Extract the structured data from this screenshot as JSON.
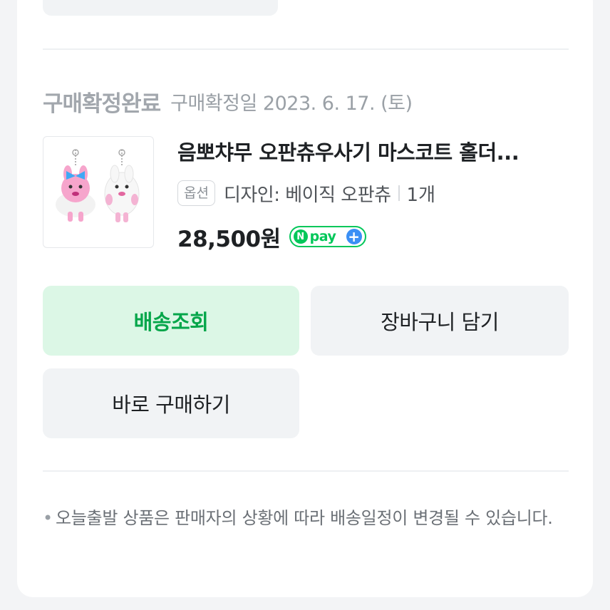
{
  "order": {
    "status_title": "구매확정완료",
    "status_date": "구매확정일 2023. 6. 17. (토)"
  },
  "product": {
    "name": "음뽀차무 오판츄우사기 마스코트 홀더 (판매 상품명 일부)",
    "name_display": "음뽀챠무 오판츄우사기 마스코트 홀더...",
    "option_badge": "옵션",
    "option_text": "디자인: 베이직 오판츄",
    "quantity": "1개",
    "price": "28,500원",
    "npay": {
      "n": "N",
      "label": "pay",
      "plus": "+"
    }
  },
  "buttons": {
    "track": "배송조회",
    "cart": "장바구니 담기",
    "buy": "바로 구매하기"
  },
  "notice": {
    "bullet": "•",
    "text": "오늘출발 상품은 판매자의 상황에 따라 배송일정이 변경될 수 있습니다."
  },
  "colors": {
    "accent_green": "#05a64a",
    "button_green_bg": "#dcf7e6",
    "npay_green": "#03c75a",
    "npay_blue": "#3b8ff5"
  }
}
